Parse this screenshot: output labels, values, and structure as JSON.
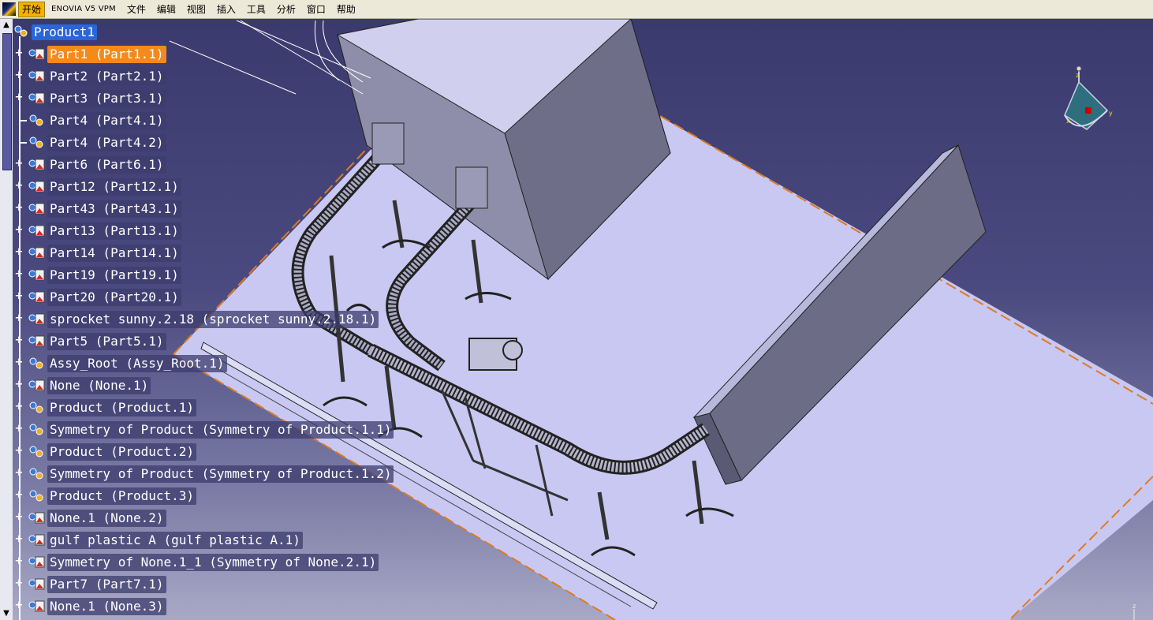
{
  "menu": {
    "items": [
      "开始",
      "ENOVIA V5 VPM",
      "文件",
      "编辑",
      "视图",
      "插入",
      "工具",
      "分析",
      "窗口",
      "帮助"
    ]
  },
  "tree": {
    "root": "Product1",
    "nodes": [
      {
        "label": "Part1 (Part1.1)",
        "type": "part",
        "state": "selected",
        "expander": "+"
      },
      {
        "label": "Part2 (Part2.1)",
        "type": "part",
        "expander": "+"
      },
      {
        "label": "Part3 (Part3.1)",
        "type": "part",
        "expander": "+"
      },
      {
        "label": "Part4 (Part4.1)",
        "type": "product",
        "expander": ""
      },
      {
        "label": "Part4 (Part4.2)",
        "type": "product",
        "expander": ""
      },
      {
        "label": "Part6 (Part6.1)",
        "type": "part",
        "expander": "+"
      },
      {
        "label": "Part12 (Part12.1)",
        "type": "part",
        "expander": "+"
      },
      {
        "label": "Part43 (Part43.1)",
        "type": "part",
        "expander": "+"
      },
      {
        "label": "Part13 (Part13.1)",
        "type": "part",
        "expander": "+"
      },
      {
        "label": "Part14 (Part14.1)",
        "type": "part",
        "expander": "+"
      },
      {
        "label": "Part19 (Part19.1)",
        "type": "part",
        "expander": "+"
      },
      {
        "label": "Part20 (Part20.1)",
        "type": "part",
        "expander": "+"
      },
      {
        "label": "sprocket sunny.2.18 (sprocket sunny.2.18.1)",
        "type": "part",
        "expander": "+"
      },
      {
        "label": "Part5 (Part5.1)",
        "type": "part",
        "expander": "+"
      },
      {
        "label": "Assy_Root (Assy_Root.1)",
        "type": "product",
        "expander": "+"
      },
      {
        "label": "None (None.1)",
        "type": "part",
        "expander": "+"
      },
      {
        "label": "Product (Product.1)",
        "type": "product",
        "expander": "+"
      },
      {
        "label": "Symmetry of Product (Symmetry of Product.1.1)",
        "type": "product",
        "expander": "+"
      },
      {
        "label": "Product (Product.2)",
        "type": "product",
        "expander": "+"
      },
      {
        "label": "Symmetry of Product (Symmetry of Product.1.2)",
        "type": "product",
        "expander": "+"
      },
      {
        "label": "Product (Product.3)",
        "type": "product",
        "expander": "+"
      },
      {
        "label": "None.1 (None.2)",
        "type": "part",
        "expander": "+"
      },
      {
        "label": "gulf plastic A (gulf plastic A.1)",
        "type": "part",
        "expander": "+"
      },
      {
        "label": "Symmetry of None.1_1 (Symmetry of None.2.1)",
        "type": "part",
        "expander": "+"
      },
      {
        "label": "Part7 (Part7.1)",
        "type": "part",
        "expander": "+"
      },
      {
        "label": "None.1 (None.3)",
        "type": "part",
        "expander": "+"
      }
    ]
  },
  "scrollbar": {
    "up": "▲",
    "down": "▼"
  },
  "triad": {
    "x": "x",
    "y": "y",
    "z": "z"
  },
  "compass": {
    "x": "x",
    "y": "y",
    "z": "z"
  },
  "colors": {
    "background_top": "#3a3a6e",
    "floor": "#c8c8f0",
    "box": "#7a7a96",
    "selection": "#f28a1e",
    "root_highlight": "#2a66d8"
  }
}
